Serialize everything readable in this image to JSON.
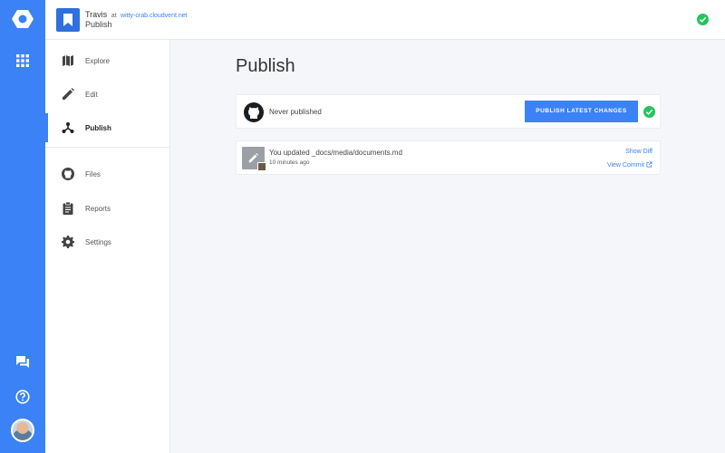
{
  "colors": {
    "accent": "#3b82f6",
    "success": "#22c55e",
    "rail": "#3b82f6"
  },
  "rail": {
    "icons": [
      "cloudvent-logo-icon",
      "apps-grid-icon",
      "chat-icon",
      "help-icon",
      "avatar"
    ]
  },
  "header": {
    "user": "Travis",
    "at": "at",
    "domain": "witty-crab.cloudvent.net",
    "page": "Publish"
  },
  "sidebar": {
    "items": [
      {
        "label": "Explore",
        "icon": "map-icon"
      },
      {
        "label": "Edit",
        "icon": "pencil-icon"
      },
      {
        "label": "Publish",
        "icon": "publish-icon"
      },
      {
        "label": "Files",
        "icon": "github-icon"
      },
      {
        "label": "Reports",
        "icon": "clipboard-icon"
      },
      {
        "label": "Settings",
        "icon": "gear-icon"
      }
    ]
  },
  "main": {
    "title": "Publish",
    "publish_card": {
      "status": "Never published",
      "button": "PUBLISH LATEST CHANGES"
    },
    "commit": {
      "message": "You updated _docs/media/documents.md",
      "time": "10 minutes ago",
      "show_diff": "Show Diff",
      "view_commit": "View Commit"
    }
  }
}
